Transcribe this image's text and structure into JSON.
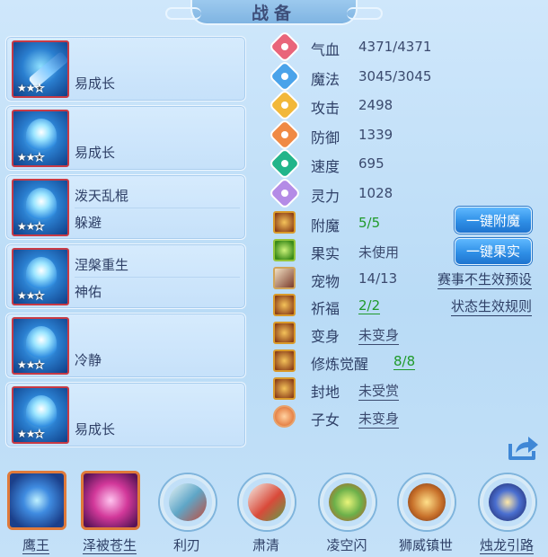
{
  "title": "战备",
  "equipment": [
    {
      "line1": "",
      "line2": "易成长",
      "stars": 2,
      "icon": "sword-icon"
    },
    {
      "line1": "",
      "line2": "易成长",
      "stars": 2,
      "icon": "crown-icon"
    },
    {
      "line1": "泼天乱棍",
      "line2": "躲避",
      "stars": 2,
      "icon": "armor-icon"
    },
    {
      "line1": "涅槃重生",
      "line2": "神佑",
      "stars": 2,
      "icon": "necklace-icon"
    },
    {
      "line1": "",
      "line2": "冷静",
      "stars": 2,
      "icon": "belt-icon"
    },
    {
      "line1": "",
      "line2": "易成长",
      "stars": 2,
      "icon": "boots-icon"
    }
  ],
  "stats": [
    {
      "label": "气血",
      "value": "4371/4371",
      "color": "#e9657a",
      "icon": "heart-icon"
    },
    {
      "label": "魔法",
      "value": "3045/3045",
      "color": "#4aa3ea",
      "icon": "mana-icon"
    },
    {
      "label": "攻击",
      "value": "2498",
      "color": "#f2b83a",
      "icon": "sword-icon"
    },
    {
      "label": "防御",
      "value": "1339",
      "color": "#f08a45",
      "icon": "shield-icon"
    },
    {
      "label": "速度",
      "value": "695",
      "color": "#22b58a",
      "icon": "lightning-icon"
    },
    {
      "label": "灵力",
      "value": "1028",
      "color": "#b48be6",
      "icon": "spirit-icon"
    }
  ],
  "props": [
    {
      "label": "附魔",
      "value": "5/5",
      "style": "g",
      "icon": "enchant-icon"
    },
    {
      "label": "果实",
      "value": "未使用",
      "style": "",
      "icon": "fruit-icon"
    },
    {
      "label": "宠物",
      "value": "14/13",
      "style": "",
      "icon": "pet-icon"
    },
    {
      "label": "祈福",
      "value": "2/2",
      "style": "gu",
      "icon": "blessing-icon"
    },
    {
      "label": "变身",
      "value": "未变身",
      "style": "u",
      "icon": "transform-icon"
    },
    {
      "label": "修炼觉醒",
      "value": "8/8",
      "style": "gu",
      "icon": "cultivation-icon"
    },
    {
      "label": "封地",
      "value": "未受赏",
      "style": "u",
      "icon": "fief-icon"
    },
    {
      "label": "子女",
      "value": "未变身",
      "style": "u",
      "icon": "child-icon"
    }
  ],
  "buttons": {
    "enchant": "一键附魔",
    "fruit": "一键果实",
    "event_preset": "赛事不生效预设",
    "status_rules": "状态生效规则"
  },
  "skills": [
    {
      "name": "鹰王",
      "shape": "square",
      "underline": true,
      "color": "#2a5fb8"
    },
    {
      "name": "泽被苍生",
      "shape": "square",
      "underline": true,
      "color": "#c2339a"
    },
    {
      "name": "利刃",
      "shape": "circle",
      "underline": false,
      "color": "#5fa6c7"
    },
    {
      "name": "肃清",
      "shape": "circle",
      "underline": false,
      "color": "#d94a3a"
    },
    {
      "name": "凌空闪",
      "shape": "circle",
      "underline": false,
      "color": "#6cb04a"
    },
    {
      "name": "狮威镇世",
      "shape": "circle",
      "underline": false,
      "color": "#c7702a"
    },
    {
      "name": "烛龙引路",
      "shape": "circle",
      "underline": true,
      "color": "#2c3f9a"
    }
  ]
}
